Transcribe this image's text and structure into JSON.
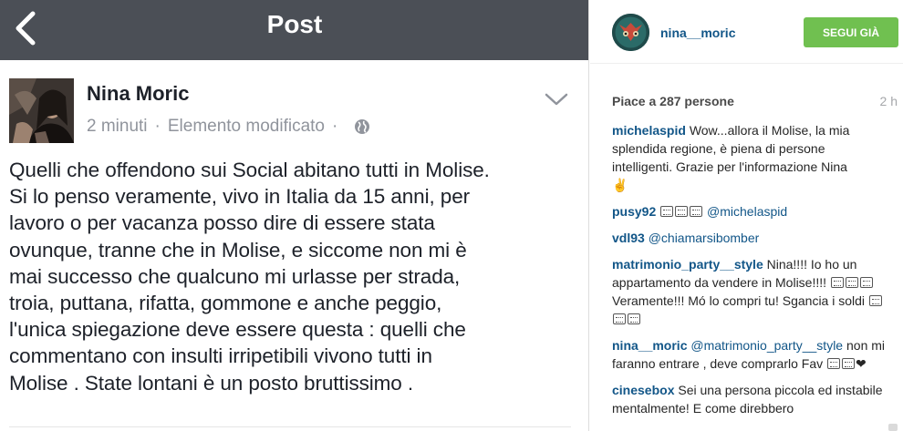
{
  "facebook": {
    "header_title": "Post",
    "author_name": "Nina Moric",
    "time": "2 minuti",
    "separator": "·",
    "edited_label": "Elemento modificato",
    "post_text": "Quelli che offendono sui Social abitano tutti in Molise.\nSi lo penso veramente, vivo in Italia da 15 anni, per\nlavoro o per vacanza posso dire di essere stata\novunque, tranne che in Molise, e siccome non mi è\nmai successo che qualcuno mi urlasse per strada,\ntroia, puttana, rifatta, gommone e anche peggio,\nl'unica spiegazione deve essere questa : quelli che\ncommentano con insulti irripetibili vivono tutti in\nMolise . State lontani è un posto bruttissimo ."
  },
  "instagram": {
    "username": "nina__moric",
    "follow_label": "SEGUI GIÀ",
    "follow_color": "#70c050",
    "likes": "Piace a 287 persone",
    "time_ago": "2 h",
    "comments": [
      {
        "user": "michelaspid",
        "text": "Wow...allora il Molise, la mia splendida regione, è piena di persone intelligenti. Grazie per l'informazione Nina",
        "tail": "✌"
      },
      {
        "user": "pusy92",
        "mention": "@michelaspid"
      },
      {
        "user": "vdl93",
        "mention": "@chiamarsibomber"
      },
      {
        "user": "matrimonio_party__style",
        "text1": "Nina!!!! Io ho un appartamento da vendere in Molise!!!!",
        "text2": "Veramente!!! Mó lo compri tu! Sgancia i soldi"
      },
      {
        "user": "nina__moric",
        "mention": "@matrimonio_party__style",
        "text": "non mi faranno entrare , deve comprarlo Fav",
        "tail": "❤"
      },
      {
        "user": "cinesebox",
        "text": "Sei una persona piccola ed instabile mentalmente! E come direbbero"
      }
    ]
  }
}
